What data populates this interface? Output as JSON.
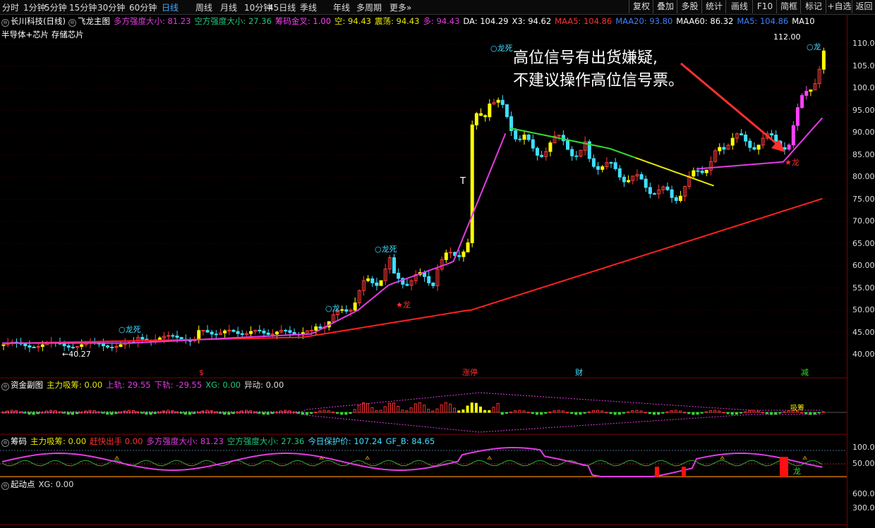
{
  "toolbar": {
    "timeframes": [
      "分时",
      "1分钟",
      "5分钟",
      "15分钟",
      "30分钟",
      "60分钟",
      "日线",
      "周线",
      "月线",
      "10分钟",
      "45日线",
      "季线",
      "年线",
      "多周期",
      "更多»"
    ],
    "active_timeframe": "日线",
    "right_buttons": [
      "复权",
      "叠加",
      "多股",
      "统计",
      "画线",
      "F10",
      "简框",
      "标记",
      "+自选",
      "返回"
    ]
  },
  "main": {
    "stock": "长川科技(日线)",
    "indicator": "飞龙主图",
    "readouts": [
      {
        "label": "多方强度大小:",
        "value": "81.23",
        "color": "#e23ce2"
      },
      {
        "label": "空方强度大小:",
        "value": "27.36",
        "color": "#22c77a"
      },
      {
        "label": "筹码金叉:",
        "value": "1.00",
        "color": "#ff40ff"
      },
      {
        "label": "空:",
        "value": "94.43",
        "color": "#e8e800"
      },
      {
        "label": "震荡:",
        "value": "94.43",
        "color": "#e8e800"
      },
      {
        "label": "多:",
        "value": "94.43",
        "color": "#e23ce2"
      },
      {
        "label": "DA:",
        "value": "104.29",
        "color": "#ffffff"
      },
      {
        "label": "X3:",
        "value": "94.62",
        "color": "#ffffff"
      },
      {
        "label": "MAA5:",
        "value": "104.86",
        "color": "#ff3030"
      },
      {
        "label": "MAA20:",
        "value": "93.80",
        "color": "#3f7fff"
      },
      {
        "label": "MAA60:",
        "value": "86.32",
        "color": "#ffffff"
      },
      {
        "label": "MA5:",
        "value": "104.86",
        "color": "#3f7fff"
      },
      {
        "label": "MA10",
        "value": "",
        "color": "#ffffff"
      }
    ],
    "sector": "半导体+芯片 存储芯片",
    "annotation_line1": "高位信号有出货嫌疑,",
    "annotation_line2": "不建议操作高位信号票。",
    "labels": {
      "high": "112.00",
      "low": "40.27",
      "dragon": "龙",
      "dragon_death": "龙死",
      "star_dragon": "★龙",
      "t_marker": "T",
      "bottom_tags": [
        "$",
        "涨停",
        "财",
        "减"
      ]
    },
    "y_ticks": [
      "110.00",
      "105.00",
      "100.00",
      "95.00",
      "90.00",
      "85.00",
      "80.00",
      "75.00",
      "70.00",
      "65.00",
      "60.00",
      "55.00",
      "50.00",
      "45.00",
      "40.00"
    ]
  },
  "fund_panel": {
    "title": "资金副图",
    "readouts": [
      {
        "label": "主力吸筹:",
        "value": "0.00",
        "color": "#e8e800"
      },
      {
        "label": "上轨:",
        "value": "29.55",
        "color": "#e23ce2"
      },
      {
        "label": "下轨:",
        "value": "-29.55",
        "color": "#e23ce2"
      },
      {
        "label": "XG:",
        "value": "0.00",
        "color": "#22c77a"
      },
      {
        "label": "异动:",
        "value": "0.00",
        "color": "#dddddd"
      }
    ],
    "tag": "吸筹"
  },
  "chip_panel": {
    "title": "筹码",
    "readouts": [
      {
        "label": "主力吸筹:",
        "value": "0.00",
        "color": "#e8e800"
      },
      {
        "label": "赶快出手",
        "value": "0.00",
        "color": "#ff3030"
      },
      {
        "label": "多方强度大小:",
        "value": "81.23",
        "color": "#e23ce2"
      },
      {
        "label": "空方强度大小:",
        "value": "27.36",
        "color": "#22c77a"
      },
      {
        "label": "今日保护价:",
        "value": "107.24",
        "color": "#3fdfff"
      },
      {
        "label": "GF_B:",
        "value": "84.65",
        "color": "#3fdfff"
      }
    ],
    "y_ticks": [
      "100.00",
      "50.00"
    ],
    "tag": "龙"
  },
  "start_panel": {
    "title": "起动点",
    "readouts": [
      {
        "label": "XG:",
        "value": "0.00",
        "color": "#dddddd"
      }
    ],
    "y_ticks": [
      "600.00",
      "300.00"
    ]
  }
}
